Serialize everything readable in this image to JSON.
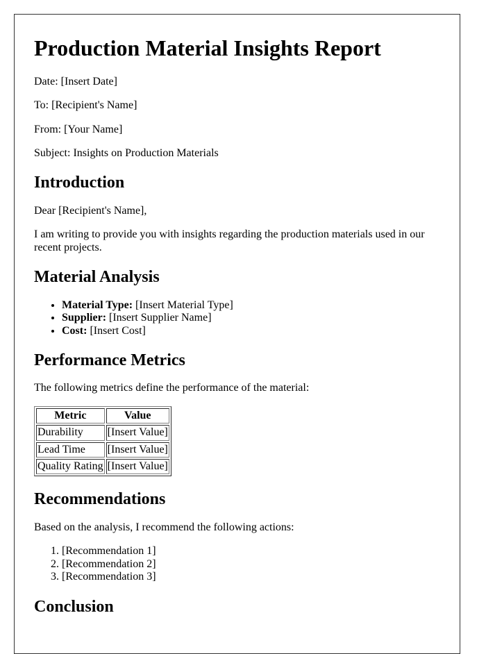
{
  "document": {
    "title": "Production Material Insights Report",
    "meta": {
      "date_label": "Date:",
      "date_value": "[Insert Date]",
      "to_label": "To:",
      "to_value": "[Recipient's Name]",
      "from_label": "From:",
      "from_value": "[Your Name]",
      "subject_label": "Subject:",
      "subject_value": "Insights on Production Materials"
    },
    "introduction": {
      "heading": "Introduction",
      "salutation": "Dear [Recipient's Name],",
      "body": "I am writing to provide you with insights regarding the production materials used in our recent projects."
    },
    "material_analysis": {
      "heading": "Material Analysis",
      "items": [
        {
          "label": "Material Type:",
          "value": "[Insert Material Type]"
        },
        {
          "label": "Supplier:",
          "value": "[Insert Supplier Name]"
        },
        {
          "label": "Cost:",
          "value": "[Insert Cost]"
        }
      ]
    },
    "performance_metrics": {
      "heading": "Performance Metrics",
      "intro": "The following metrics define the performance of the material:",
      "table": {
        "headers": [
          "Metric",
          "Value"
        ],
        "rows": [
          [
            "Durability",
            "[Insert Value]"
          ],
          [
            "Lead Time",
            "[Insert Value]"
          ],
          [
            "Quality Rating",
            "[Insert Value]"
          ]
        ]
      }
    },
    "recommendations": {
      "heading": "Recommendations",
      "intro": "Based on the analysis, I recommend the following actions:",
      "items": [
        "[Recommendation 1]",
        "[Recommendation 2]",
        "[Recommendation 3]"
      ]
    },
    "conclusion": {
      "heading": "Conclusion"
    }
  }
}
